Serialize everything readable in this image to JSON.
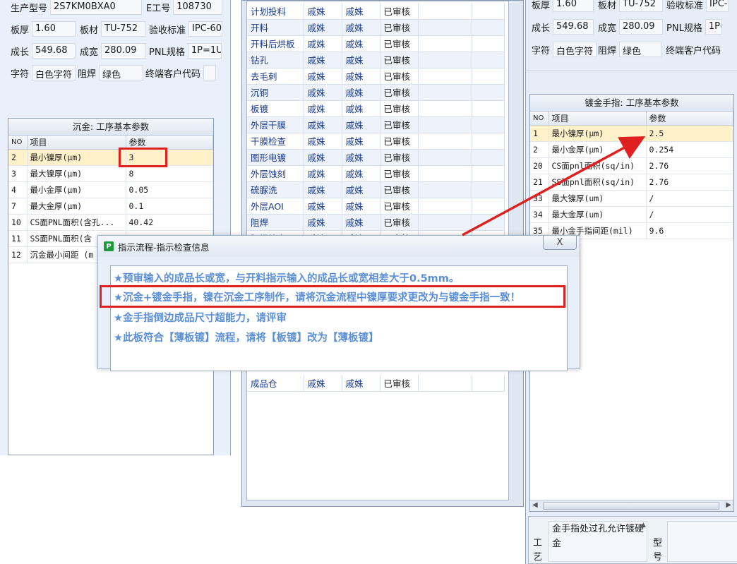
{
  "left_form": {
    "rows": [
      [
        {
          "label": "生产型号",
          "value": "2S7KM0BXA0"
        },
        {
          "label": "E工号",
          "value": "108730"
        }
      ],
      [
        {
          "label": "板厚",
          "value": "1.60"
        },
        {
          "label": "板材",
          "value": "TU-752"
        },
        {
          "label": "验收标准",
          "value": "IPC-60"
        }
      ],
      [
        {
          "label": "成长",
          "value": "549.68"
        },
        {
          "label": "成宽",
          "value": "280.09"
        },
        {
          "label": "PNL规格",
          "value": "1P=1U"
        }
      ],
      [
        {
          "label": "字符",
          "value": "白色字符"
        },
        {
          "label": "阻焊",
          "value": "绿色"
        },
        {
          "label": "终端客户代码",
          "value": ""
        }
      ]
    ]
  },
  "left_param": {
    "title": "沉金: 工序基本参数",
    "headers": {
      "no": "NO",
      "item": "项目",
      "param": "参数"
    },
    "rows": [
      {
        "no": "2",
        "item": "最小镍厚(μm)",
        "value": "3"
      },
      {
        "no": "3",
        "item": "最大镍厚(μm)",
        "value": "8"
      },
      {
        "no": "4",
        "item": "最小金厚(μm)",
        "value": "0.05"
      },
      {
        "no": "7",
        "item": "最大金厚(μm)",
        "value": "0.1"
      },
      {
        "no": "10",
        "item": "CS面PNL面积(含孔...",
        "value": "40.42"
      },
      {
        "no": "11",
        "item": "SS面PNL面积(含",
        "value": ""
      },
      {
        "no": "12",
        "item": "沉金最小间距 (m",
        "value": ""
      }
    ]
  },
  "mid_table": {
    "rows": [
      {
        "step": "计划投料",
        "a": "戚姝",
        "b": "戚姝",
        "status": "已审核"
      },
      {
        "step": "开料",
        "a": "戚姝",
        "b": "戚姝",
        "status": "已审核"
      },
      {
        "step": "开料后烘板",
        "a": "戚姝",
        "b": "戚姝",
        "status": "已审核"
      },
      {
        "step": "钻孔",
        "a": "戚姝",
        "b": "戚姝",
        "status": "已审核"
      },
      {
        "step": "去毛刺",
        "a": "戚姝",
        "b": "戚姝",
        "status": "已审核"
      },
      {
        "step": "沉铜",
        "a": "戚姝",
        "b": "戚姝",
        "status": "已审核"
      },
      {
        "step": "板镀",
        "a": "戚姝",
        "b": "戚姝",
        "status": "已审核"
      },
      {
        "step": "外层干膜",
        "a": "戚姝",
        "b": "戚姝",
        "status": "已审核"
      },
      {
        "step": "干膜检查",
        "a": "戚姝",
        "b": "戚姝",
        "status": "已审核"
      },
      {
        "step": "图形电镀",
        "a": "戚姝",
        "b": "戚姝",
        "status": "已审核"
      },
      {
        "step": "外层蚀刻",
        "a": "戚姝",
        "b": "戚姝",
        "status": "已审核"
      },
      {
        "step": "硫脲洗",
        "a": "戚姝",
        "b": "戚姝",
        "status": "已审核"
      },
      {
        "step": "外层AOI",
        "a": "戚姝",
        "b": "戚姝",
        "status": "已审核"
      },
      {
        "step": "阻焊",
        "a": "戚姝",
        "b": "戚姝",
        "status": "已审核"
      },
      {
        "step": "阻焊检查",
        "a": "戚姝",
        "b": "戚姝",
        "status": "已审核"
      }
    ],
    "last_row": {
      "step": "成品仓",
      "a": "戚姝",
      "b": "戚姝",
      "status": "已审核"
    }
  },
  "right_form": {
    "rows": [
      [
        {
          "label": "板厚",
          "value": "1.60"
        },
        {
          "label": "板材",
          "value": "TU-752"
        },
        {
          "label": "验收标准",
          "value": "IPC-"
        }
      ],
      [
        {
          "label": "成长",
          "value": "549.68"
        },
        {
          "label": "成宽",
          "value": "280.09"
        },
        {
          "label": "PNL规格",
          "value": "1P="
        }
      ],
      [
        {
          "label": "字符",
          "value": "白色字符"
        },
        {
          "label": "阻焊",
          "value": "绿色"
        },
        {
          "label": "终端客户代码",
          "value": ""
        }
      ]
    ]
  },
  "right_param": {
    "title": "镀金手指: 工序基本参数",
    "headers": {
      "no": "NO",
      "item": "项目",
      "param": "参数"
    },
    "rows": [
      {
        "no": "1",
        "item": "最小镍厚(μm)",
        "value": "2.5"
      },
      {
        "no": "2",
        "item": "最小金厚(μm)",
        "value": "0.254"
      },
      {
        "no": "20",
        "item": "CS面pnl面积(sq/in)",
        "value": "2.76"
      },
      {
        "no": "21",
        "item": "SS面pnl面积(sq/in)",
        "value": "2.76"
      },
      {
        "no": "33",
        "item": "最大镍厚(um)",
        "value": "/"
      },
      {
        "no": "34",
        "item": "最大金厚(um)",
        "value": "/"
      },
      {
        "no": "35",
        "item": "最小金手指间距(mil)",
        "value": "9.6"
      }
    ]
  },
  "right_bottom": {
    "label_gongyi": "工艺",
    "note": "金手指处过孔允许镀硬金",
    "label_xinghao": "型号"
  },
  "dialog": {
    "title": "指示流程-指示检查信息",
    "close_glyph": "X",
    "icon_letter": "P",
    "messages": [
      "★预审输入的成品长或宽，与开料指示输入的成品长或宽相差大于0.5mm。",
      "★沉金+镀金手指，镍在沉金工序制作，请将沉金流程中镍厚要求更改为与镀金手指一致！",
      "★金手指倒边成品尺寸超能力，请评审",
      "★此板符合【薄板镀】流程，请将【板镀】改为【薄板镀】"
    ]
  },
  "colors": {
    "highlight_red": "#e02020",
    "message_blue": "#5b8fd6",
    "selected_row": "#fff1c9"
  }
}
